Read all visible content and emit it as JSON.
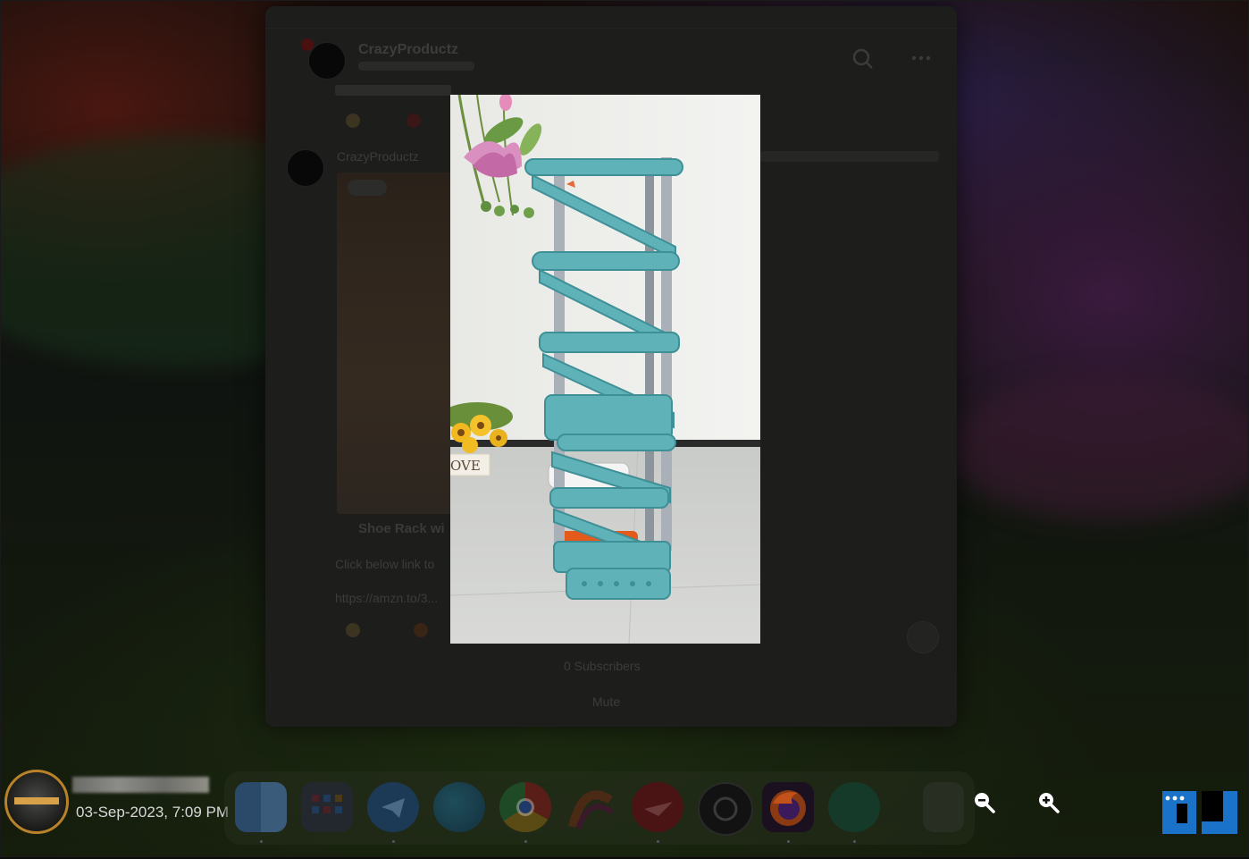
{
  "app": {
    "channel_name": "CrazyProductz",
    "post_text_1": "Shoe Rack wi",
    "post_text_2": "Click below link to",
    "link_partial": "https://amzn.to/3...",
    "footer_1": "0 Subscribers",
    "footer_2": "Mute"
  },
  "viewer": {
    "product_caption": "Shoe Rack",
    "sign_text": "OVE"
  },
  "overlay": {
    "timestamp": "03-Sep-2023, 7:09 PM"
  },
  "dock": {
    "apps": [
      "finder",
      "launchpad",
      "telegram",
      "edge",
      "chrome",
      "arc",
      "paper-plane",
      "chatgpt",
      "firefox",
      "app-store",
      "trash"
    ]
  },
  "zoom": {
    "out_icon": "zoom-out-icon",
    "in_icon": "zoom-in-icon"
  },
  "colors": {
    "rack": "#5fb3b8",
    "rack_dark": "#3f8f97",
    "pole": "#9aa3ac"
  }
}
